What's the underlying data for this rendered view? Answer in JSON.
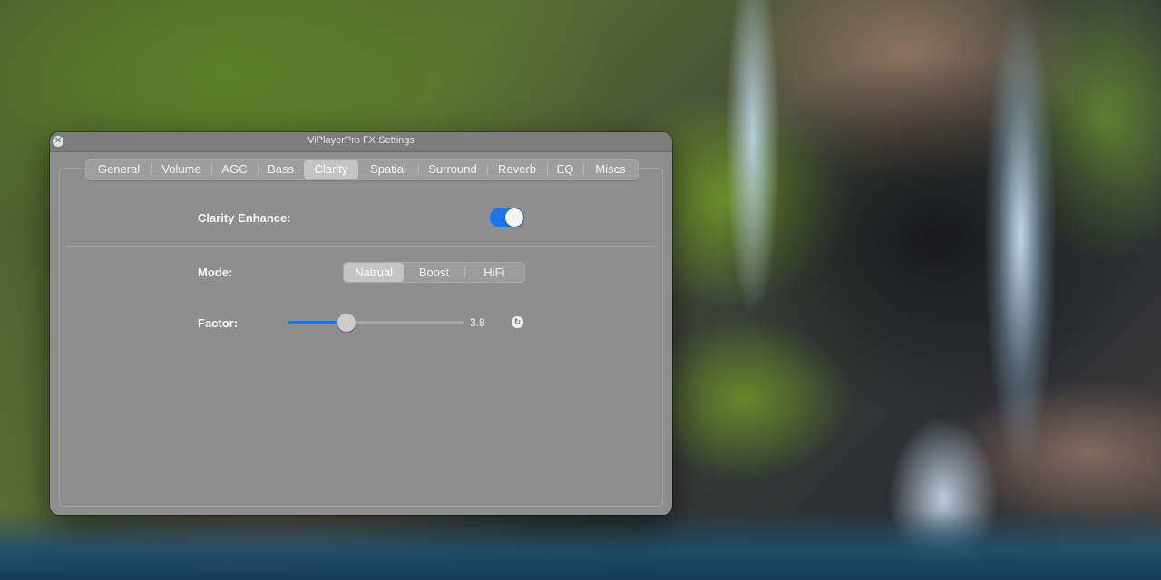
{
  "window": {
    "title": "ViPlayerPro FX Settings"
  },
  "tabs": [
    {
      "label": "General",
      "active": false
    },
    {
      "label": "Volume",
      "active": false
    },
    {
      "label": "AGC",
      "active": false
    },
    {
      "label": "Bass",
      "active": false
    },
    {
      "label": "Clarity",
      "active": true
    },
    {
      "label": "Spatial",
      "active": false
    },
    {
      "label": "Surround",
      "active": false
    },
    {
      "label": "Reverb",
      "active": false
    },
    {
      "label": "EQ",
      "active": false
    },
    {
      "label": "Miscs",
      "active": false
    }
  ],
  "clarity": {
    "enhance_label": "Clarity Enhance:",
    "enhance_on": true,
    "mode_label": "Mode:",
    "modes": [
      "Natrual",
      "Boost",
      "HiFi"
    ],
    "selected_mode": "Natrual",
    "factor_label": "Factor:",
    "factor_value": "3.8",
    "factor_fraction": 0.33
  },
  "icons": {
    "close": "close-icon",
    "reset": "reset-icon"
  },
  "colors": {
    "accent": "#1a73e8"
  }
}
